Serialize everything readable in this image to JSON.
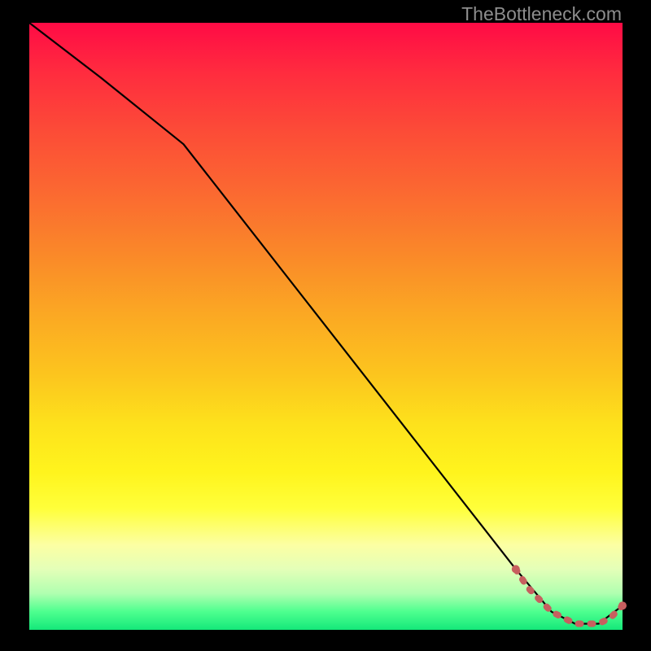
{
  "watermark": "TheBottleneck.com",
  "colors": {
    "line": "#000000",
    "dash": "#c75f5f",
    "marker_fill": "#c75f5f",
    "marker_stroke": "#c75f5f"
  },
  "chart_data": {
    "type": "line",
    "title": "",
    "xlabel": "",
    "ylabel": "",
    "xlim": [
      0,
      100
    ],
    "ylim": [
      0,
      100
    ],
    "series": [
      {
        "name": "main-curve",
        "style": "solid",
        "x": [
          0,
          12,
          26,
          82,
          88,
          92,
          96,
          100
        ],
        "values": [
          100,
          91,
          80,
          10,
          3,
          1,
          1,
          4
        ]
      },
      {
        "name": "dashed-segment",
        "style": "dashed",
        "x": [
          82,
          84,
          86,
          88,
          90,
          92,
          94,
          96,
          98,
          100
        ],
        "values": [
          10,
          7,
          5,
          3,
          2,
          1,
          1,
          1,
          2,
          4
        ]
      }
    ],
    "markers": [
      {
        "x": 82,
        "y": 10
      },
      {
        "x": 100,
        "y": 4
      }
    ]
  }
}
